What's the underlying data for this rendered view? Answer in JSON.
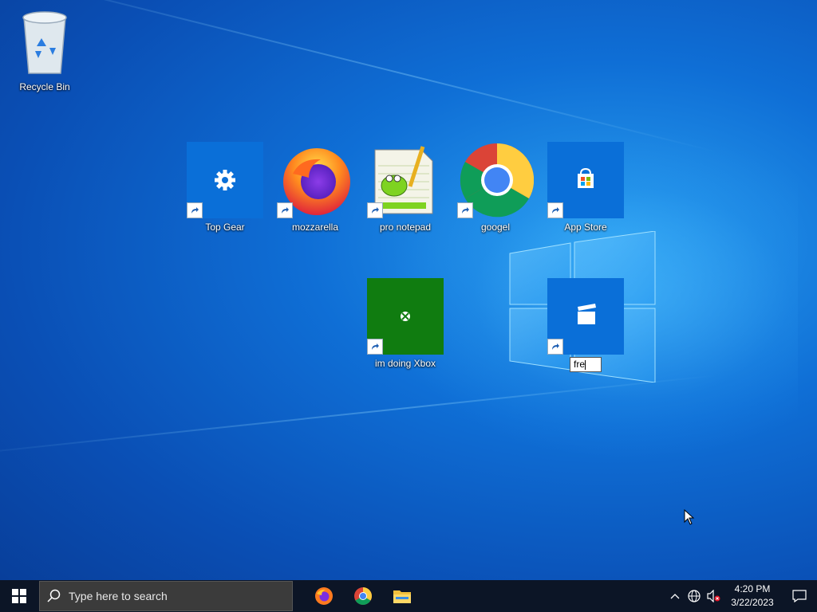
{
  "desktop": {
    "icons": [
      {
        "label": "Recycle Bin",
        "icon": "recycle-bin-icon"
      },
      {
        "label": "Top Gear",
        "icon": "settings-gear-icon"
      },
      {
        "label": "mozzarella",
        "icon": "firefox-icon"
      },
      {
        "label": "pro notepad",
        "icon": "notepad-plus-plus-icon"
      },
      {
        "label": "googel",
        "icon": "chrome-icon"
      },
      {
        "label": "App Store",
        "icon": "microsoft-store-icon"
      },
      {
        "label": "im doing Xbox",
        "icon": "xbox-icon"
      },
      {
        "label": "",
        "icon": "movies-tv-icon"
      }
    ],
    "rename_value": "fre"
  },
  "taskbar": {
    "search_placeholder": "Type here to search",
    "pinned": [
      "firefox-icon",
      "chrome-icon",
      "file-explorer-icon"
    ],
    "tray_icons": [
      "chevron-up-icon",
      "network-globe-icon",
      "speaker-muted-icon"
    ],
    "time": "4:20 PM",
    "date": "3/22/2023"
  },
  "colors": {
    "accent_tile": "#0a6fd8",
    "xbox_tile": "#107c10",
    "taskbar": "#0c1526"
  }
}
